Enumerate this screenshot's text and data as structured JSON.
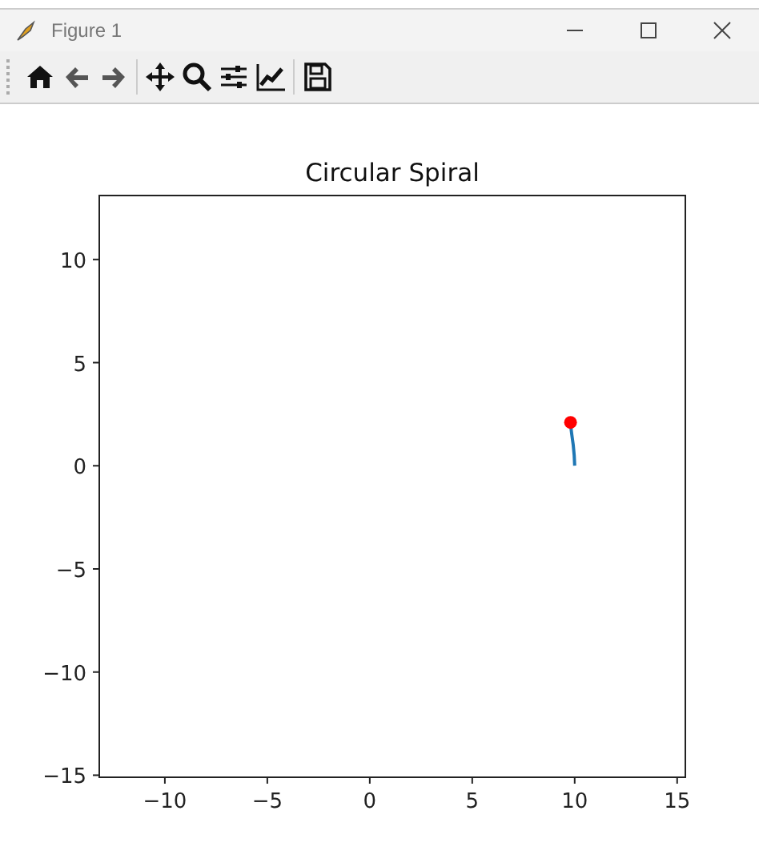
{
  "window": {
    "title": "Figure 1"
  },
  "toolbar": {
    "buttons": [
      {
        "kind": "home"
      },
      {
        "kind": "back"
      },
      {
        "kind": "forward"
      },
      {
        "kind": "pan"
      },
      {
        "kind": "zoom"
      },
      {
        "kind": "subplots"
      },
      {
        "kind": "axes"
      },
      {
        "kind": "save"
      }
    ]
  },
  "figure": {
    "chart_data": {
      "type": "line",
      "title": "Circular Spiral",
      "x": [
        10,
        9.98,
        9.93,
        9.86,
        9.8
      ],
      "xlim": [
        -13.2,
        15.4
      ],
      "ylim": [
        -15.1,
        13.1
      ],
      "xticks": [
        {
          "value": -10,
          "label": "−10"
        },
        {
          "value": -5,
          "label": "−5"
        },
        0,
        5,
        10,
        15
      ],
      "yticks": [
        {
          "value": -15,
          "label": "−15"
        },
        {
          "value": -10,
          "label": "−10"
        },
        {
          "value": -5,
          "label": "−5"
        },
        0,
        5,
        10
      ],
      "series": [
        {
          "color": "#1f77b4",
          "values": [
            0,
            0.5,
            1.0,
            1.5,
            2.0
          ]
        },
        {
          "color": "#ff0000",
          "marker": "o",
          "values": [
            null,
            null,
            null,
            null,
            2.1
          ]
        }
      ]
    }
  }
}
